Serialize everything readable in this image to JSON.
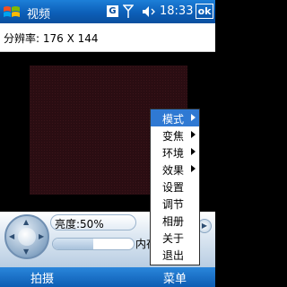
{
  "titlebar": {
    "title": "视频",
    "tray_g": "G",
    "clock": "18:33",
    "ok_label": "ok"
  },
  "info": {
    "resolution": "分辨率: 176 X 144"
  },
  "controls": {
    "brightness_label": "亮度:50%",
    "brightness_level": 0.5,
    "mode_text": "内存"
  },
  "context_menu": {
    "items": [
      {
        "label": "模式",
        "submenu": true,
        "selected": true
      },
      {
        "label": "变焦",
        "submenu": true,
        "selected": false
      },
      {
        "label": "环境",
        "submenu": true,
        "selected": false
      },
      {
        "label": "效果",
        "submenu": true,
        "selected": false
      },
      {
        "label": "设置",
        "submenu": false,
        "selected": false
      },
      {
        "label": "调节",
        "submenu": false,
        "selected": false
      },
      {
        "label": "相册",
        "submenu": false,
        "selected": false
      },
      {
        "label": "关于",
        "submenu": false,
        "selected": false
      },
      {
        "label": "退出",
        "submenu": false,
        "selected": false
      }
    ]
  },
  "softkeys": {
    "left": "拍摄",
    "right": "菜单"
  },
  "colors": {
    "titlebar": "#0c5fb8",
    "menu_highlight": "#2f79d3",
    "preview": "#2a0d12"
  }
}
